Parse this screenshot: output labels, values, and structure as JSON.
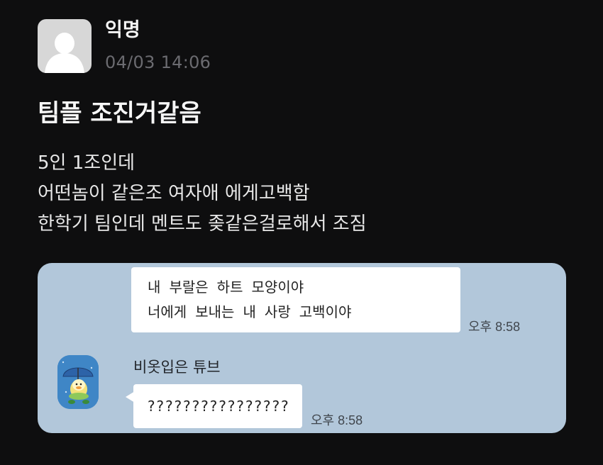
{
  "post": {
    "author": "익명",
    "timestamp": "04/03 14:06",
    "title": "팀플 조진거같음",
    "body_lines": [
      "5인 1조인데",
      "어떤놈이 같은조 여자애 에게고백함",
      "한학기 팀인데 멘트도 좆같은걸로해서 조짐"
    ]
  },
  "chat": {
    "sent_message": {
      "lines": [
        "내 부랄은 하트 모양이야",
        "너에게 보내는 내 사랑 고백이야"
      ],
      "time": "오후 8:58"
    },
    "received_message": {
      "sender": "비옷입은 튜브",
      "text": "????????????????",
      "time": "오후 8:58"
    }
  },
  "icons": {
    "author_avatar": "default-user-icon",
    "friend_avatar": "tube-raincoat-umbrella-avatar"
  },
  "colors": {
    "background": "#0e0e0f",
    "chat_background": "#b2c7da",
    "bubble": "#ffffff",
    "timestamp_gray": "#6b6b70"
  }
}
